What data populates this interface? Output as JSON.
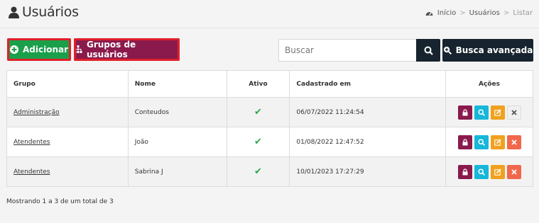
{
  "header": {
    "title": "Usuários",
    "breadcrumb": [
      "Início",
      "Usuários",
      "Listar"
    ],
    "breadcrumb_sep": ">"
  },
  "toolbar": {
    "add_label": "Adicionar",
    "groups_label": "Grupos de usuários",
    "search_placeholder": "Buscar",
    "advanced_label": "Busca avançada"
  },
  "table": {
    "columns": [
      "Grupo",
      "Nome",
      "Ativo",
      "Cadastrado em",
      "Ações"
    ],
    "rows": [
      {
        "grupo": "Administração",
        "nome": "Conteudos",
        "ativo": "✔",
        "cadastrado": "06/07/2022 11:24:54",
        "delete_enabled": false
      },
      {
        "grupo": "Atendentes",
        "nome": "João",
        "ativo": "✔",
        "cadastrado": "01/08/2022 12:47:52",
        "delete_enabled": true
      },
      {
        "grupo": "Atendentes",
        "nome": "Sabrina J",
        "ativo": "✔",
        "cadastrado": "10/01/2023 17:27:29",
        "delete_enabled": true
      }
    ]
  },
  "footer": {
    "info": "Mostrando 1 a 3 de um total de 3"
  },
  "colors": {
    "add": "#1aa04a",
    "groups": "#8a1a4c",
    "dark": "#17232e",
    "lock": "#8a1a4c",
    "view": "#17b7d9",
    "edit": "#f0a11d",
    "delete": "#f1674c",
    "check": "#2aa84a"
  },
  "icons": {
    "title": "user-icon",
    "breadcrumb": "dashboard-icon",
    "add": "plus-circle-icon",
    "groups": "sitemap-icon",
    "search": "search-icon",
    "advanced": "search-plus-icon",
    "lock": "lock-icon",
    "view": "search-icon",
    "edit": "edit-icon",
    "delete": "close-icon"
  }
}
